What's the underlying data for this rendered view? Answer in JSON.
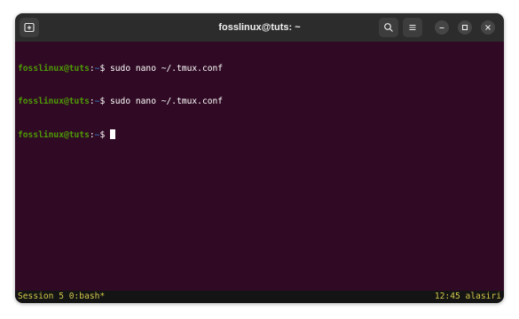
{
  "window": {
    "title": "fosslinux@tuts: ~",
    "icons": {
      "new_tab": "new-tab-icon",
      "search": "search-icon",
      "menu": "hamburger-menu-icon",
      "minimize": "minimize-icon",
      "maximize": "maximize-icon",
      "close": "close-icon"
    }
  },
  "terminal": {
    "lines": [
      {
        "user": "fosslinux@tuts",
        "path": "~",
        "prompt": "$",
        "command": " sudo nano ~/.tmux.conf"
      },
      {
        "user": "fosslinux@tuts",
        "path": "~",
        "prompt": "$",
        "command": " sudo nano ~/.tmux.conf"
      },
      {
        "user": "fosslinux@tuts",
        "path": "~",
        "prompt": "$",
        "command": " "
      }
    ],
    "colors": {
      "background": "#300a24",
      "user": "#4e9a06",
      "path": "#3465a4",
      "text": "#ffffff"
    }
  },
  "tmux_status": {
    "left": "Session 5 0:bash*",
    "right": "12:45 alasiri",
    "color": "#d4c84a"
  }
}
